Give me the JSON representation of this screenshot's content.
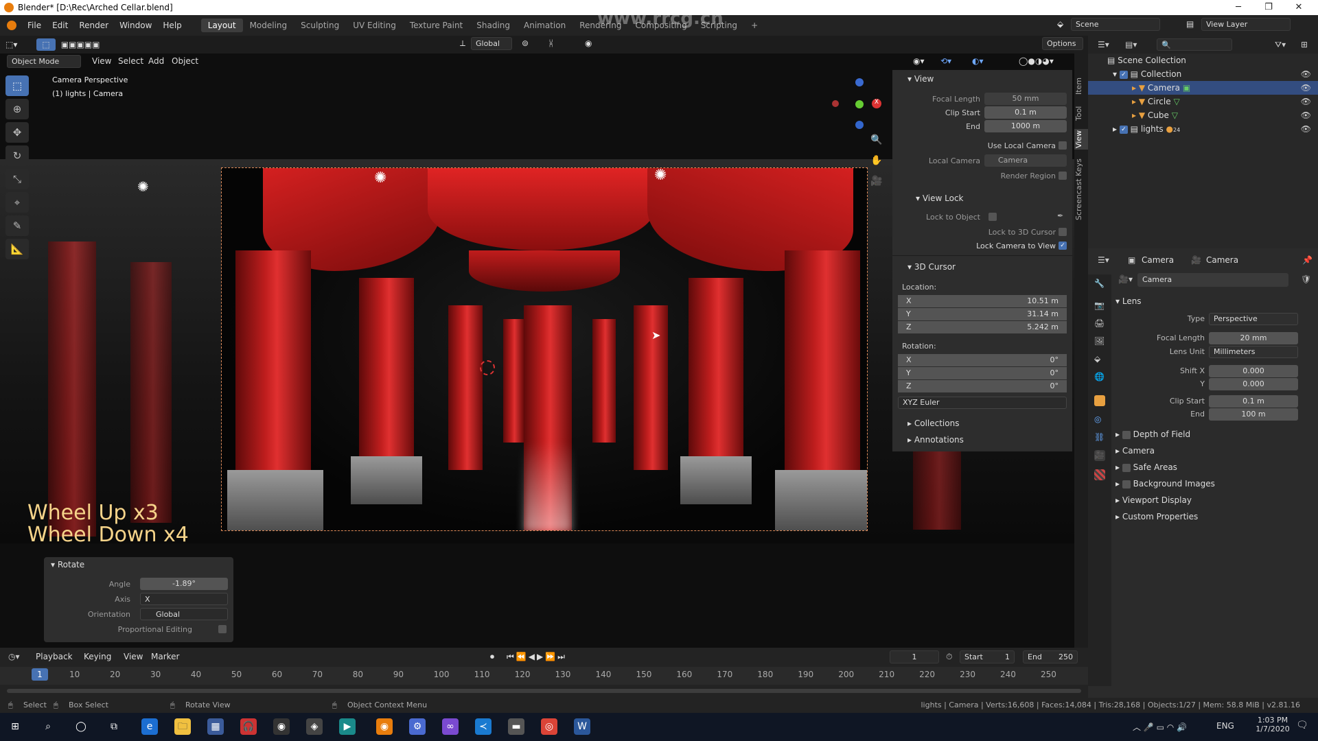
{
  "window": {
    "title": "Blender* [D:\\Rec\\Arched Cellar.blend]",
    "watermark": "www.rrcg.cn"
  },
  "menu": [
    "File",
    "Edit",
    "Render",
    "Window",
    "Help"
  ],
  "workspaces": [
    "Layout",
    "Modeling",
    "Sculpting",
    "UV Editing",
    "Texture Paint",
    "Shading",
    "Animation",
    "Rendering",
    "Compositing",
    "Scripting"
  ],
  "topbar": {
    "scene": "Scene",
    "view_layer": "View Layer",
    "transform": "Global",
    "options": "Options"
  },
  "viewport": {
    "mode": "Object Mode",
    "menus": [
      "View",
      "Select",
      "Add",
      "Object"
    ],
    "info_line1": "Camera Perspective",
    "info_line2": "(1) lights | Camera",
    "overlay_line1": "Wheel Up x3",
    "overlay_line2": "Wheel Down x4"
  },
  "rotate_panel": {
    "title": "Rotate",
    "angle_label": "Angle",
    "angle_value": "-1.89°",
    "axis_label": "Axis",
    "axis_value": "X",
    "orientation_label": "Orientation",
    "orientation_value": "Global",
    "proportional_label": "Proportional Editing"
  },
  "npanel": {
    "tabs": [
      "Item",
      "Tool",
      "View",
      "Screencast Keys"
    ],
    "view": {
      "title": "View",
      "focal_label": "Focal Length",
      "focal_value": "50 mm",
      "clip_start_label": "Clip Start",
      "clip_start_value": "0.1 m",
      "end_label": "End",
      "end_value": "1000 m",
      "use_local_camera": "Use Local Camera",
      "local_camera_label": "Local Camera",
      "local_camera_value": "Camera",
      "render_region": "Render Region"
    },
    "view_lock": {
      "title": "View Lock",
      "lock_object_label": "Lock to Object",
      "lock_cursor": "Lock to 3D Cursor",
      "lock_camera": "Lock Camera to View"
    },
    "cursor": {
      "title": "3D Cursor",
      "location_label": "Location:",
      "loc": [
        {
          "k": "X",
          "v": "10.51 m"
        },
        {
          "k": "Y",
          "v": "31.14 m"
        },
        {
          "k": "Z",
          "v": "5.242 m"
        }
      ],
      "rotation_label": "Rotation:",
      "rot": [
        {
          "k": "X",
          "v": "0°"
        },
        {
          "k": "Y",
          "v": "0°"
        },
        {
          "k": "Z",
          "v": "0°"
        }
      ],
      "mode": "XYZ Euler"
    },
    "collections": "Collections",
    "annotations": "Annotations"
  },
  "outliner": {
    "root": "Scene Collection",
    "collection": "Collection",
    "items": [
      "Camera",
      "Circle",
      "Cube"
    ],
    "lights": "lights",
    "lights_count": "24"
  },
  "properties": {
    "breadcrumb_object": "Camera",
    "breadcrumb_data": "Camera",
    "datablock": "Camera",
    "lens_title": "Lens",
    "type_label": "Type",
    "type_value": "Perspective",
    "focal_label": "Focal Length",
    "focal_value": "20 mm",
    "lens_unit_label": "Lens Unit",
    "lens_unit_value": "Millimeters",
    "shift_x_label": "Shift X",
    "shift_x_value": "0.000",
    "shift_y_label": "Y",
    "shift_y_value": "0.000",
    "clip_start_label": "Clip Start",
    "clip_start_value": "0.1 m",
    "clip_end_label": "End",
    "clip_end_value": "100 m",
    "sections": [
      "Depth of Field",
      "Camera",
      "Safe Areas",
      "Background Images",
      "Viewport Display",
      "Custom Properties"
    ]
  },
  "timeline": {
    "menus": [
      "Playback",
      "Keying",
      "View",
      "Marker"
    ],
    "current_frame": "1",
    "start_label": "Start",
    "start_value": "1",
    "end_label": "End",
    "end_value": "250",
    "ticks": [
      "1",
      "10",
      "20",
      "30",
      "40",
      "50",
      "60",
      "70",
      "80",
      "90",
      "100",
      "110",
      "120",
      "130",
      "140",
      "150",
      "160",
      "170",
      "180",
      "190",
      "200",
      "210",
      "220",
      "230",
      "240",
      "250"
    ]
  },
  "statusbar": {
    "select": "Select",
    "box_select": "Box Select",
    "rotate_view": "Rotate View",
    "context_menu": "Object Context Menu",
    "stats": "lights | Camera | Verts:16,608 | Faces:14,084 | Tris:28,168 | Objects:1/27 | Mem: 58.8 MiB | v2.81.16"
  },
  "taskbar": {
    "lang": "ENG",
    "time": "1:03 PM",
    "date": "1/7/2020"
  },
  "colors": {
    "accent": "#4772b3",
    "selected_row": "#334d80",
    "overlay_text": "#f6d48a",
    "camera_frame": "#e08c5a",
    "vault_red": "#b41a1a"
  }
}
